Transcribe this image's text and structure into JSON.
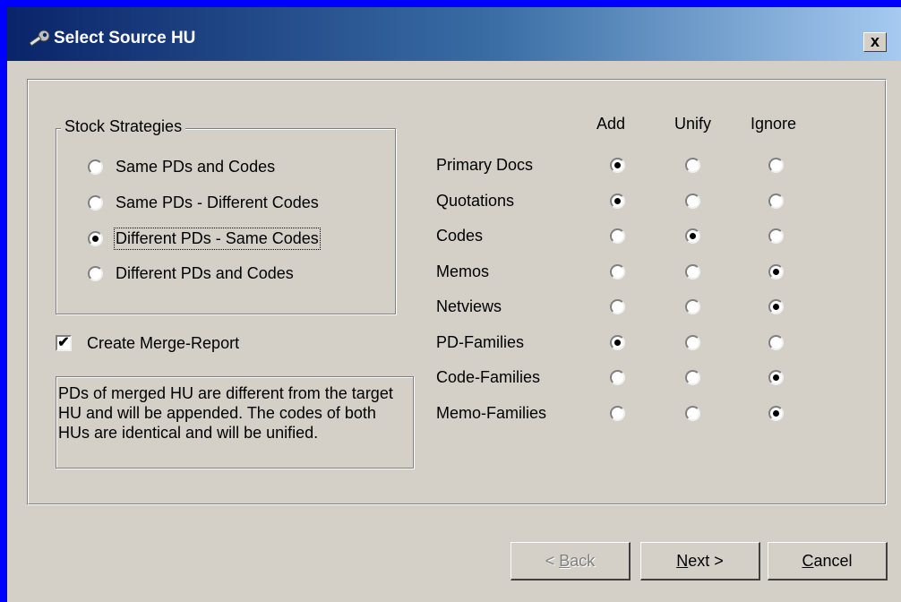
{
  "window": {
    "title": "Select Source HU",
    "close_label": "x"
  },
  "stock": {
    "legend": "Stock Strategies",
    "options": [
      {
        "label": "Same PDs and Codes",
        "selected": false
      },
      {
        "label": "Same PDs - Different Codes",
        "selected": false
      },
      {
        "label": "Different PDs - Same Codes",
        "selected": true
      },
      {
        "label": "Different PDs and Codes",
        "selected": false
      }
    ]
  },
  "merge_report": {
    "label": "Create Merge-Report",
    "checked": true
  },
  "description": "PDs of merged HU are different from the target HU and will be appended. The codes of both HUs are identical and will be unified.",
  "matrix": {
    "columns": [
      "Add",
      "Unify",
      "Ignore"
    ],
    "rows": [
      {
        "label": "Primary Docs",
        "choice": "Add"
      },
      {
        "label": "Quotations",
        "choice": "Add"
      },
      {
        "label": "Codes",
        "choice": "Unify"
      },
      {
        "label": "Memos",
        "choice": "Ignore"
      },
      {
        "label": "Netviews",
        "choice": "Ignore"
      },
      {
        "label": "PD-Families",
        "choice": "Add"
      },
      {
        "label": "Code-Families",
        "choice": "Ignore"
      },
      {
        "label": "Memo-Families",
        "choice": "Ignore"
      }
    ]
  },
  "buttons": {
    "back": {
      "label": "< Back",
      "enabled": false
    },
    "next": {
      "label": "Next >",
      "enabled": true
    },
    "cancel": {
      "label": "Cancel",
      "enabled": true
    }
  }
}
